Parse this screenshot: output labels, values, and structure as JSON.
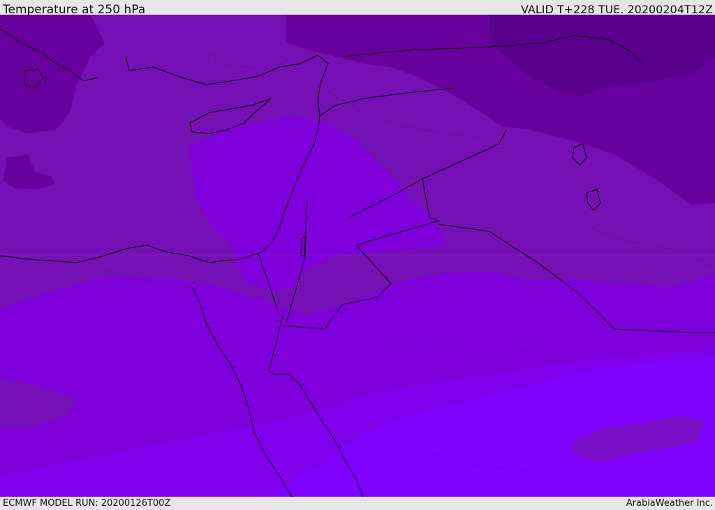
{
  "header": {
    "title": "Temperature at 250 hPa",
    "valid_time": "VALID T+228 TUE. 20200204T12Z"
  },
  "footer": {
    "model_run": "ECMWF MODEL RUN: 20200126T00Z",
    "brand": "ArabiaWeather Inc."
  },
  "map": {
    "region": "Eastern Mediterranean / Levant / Northern Red Sea",
    "colors": {
      "band_darkest": "#5a008e",
      "band_dark": "#68009e",
      "band_mid": "#7510b4",
      "band_bright": "#7f00da",
      "band_brighter": "#8000ec",
      "band_brightest": "#8000ff",
      "coastline": "#000000",
      "border": "#000000"
    }
  }
}
